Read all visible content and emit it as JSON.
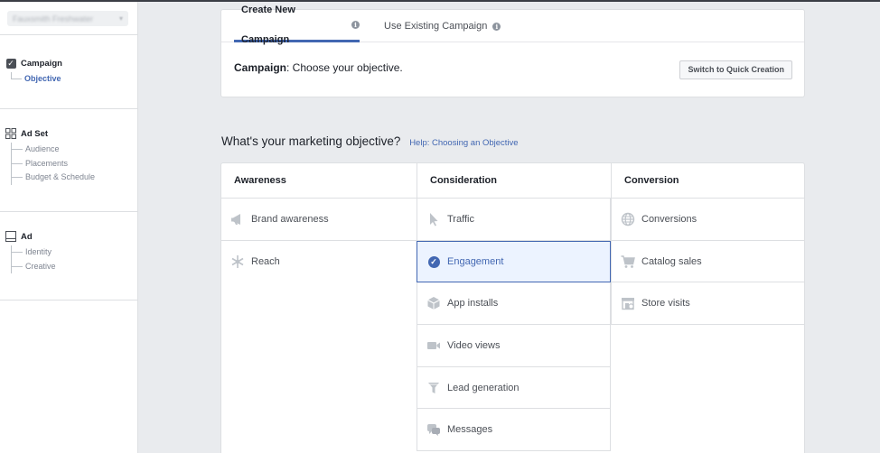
{
  "account": {
    "name": "Fauxsmith Freshwater",
    "caret": "▾"
  },
  "sidebar": {
    "campaign": {
      "title": "Campaign",
      "items": [
        "Objective"
      ]
    },
    "adset": {
      "title": "Ad Set",
      "items": [
        "Audience",
        "Placements",
        "Budget & Schedule"
      ]
    },
    "ad": {
      "title": "Ad",
      "items": [
        "Identity",
        "Creative"
      ]
    }
  },
  "tabs": [
    {
      "label": "Create New Campaign"
    },
    {
      "label": "Use Existing Campaign"
    }
  ],
  "campaign_row": {
    "bold": "Campaign",
    "rest": ": Choose your objective."
  },
  "quick_button": "Switch to Quick Creation",
  "heading": {
    "title": "What's your marketing objective?",
    "help": "Help: Choosing an Objective"
  },
  "objectives": {
    "awareness": {
      "title": "Awareness",
      "items": [
        "Brand awareness",
        "Reach"
      ]
    },
    "consideration": {
      "title": "Consideration",
      "items": [
        "Traffic",
        "Engagement",
        "App installs",
        "Video views",
        "Lead generation",
        "Messages"
      ],
      "selected": "Engagement"
    },
    "conversion": {
      "title": "Conversion",
      "items": [
        "Conversions",
        "Catalog sales",
        "Store visits"
      ]
    }
  },
  "colors": {
    "accent": "#4267b2",
    "selected_bg": "#ecf3ff",
    "border": "#dddfe2",
    "page_bg": "#e9ebee"
  },
  "icons": {
    "brand_awareness": "megaphone-icon",
    "reach": "asterisk-icon",
    "traffic": "cursor-icon",
    "engagement": "check-circle-icon",
    "app_installs": "box-icon",
    "video_views": "video-camera-icon",
    "lead_generation": "funnel-icon",
    "messages": "chat-bubbles-icon",
    "conversions": "globe-icon",
    "catalog_sales": "cart-icon",
    "store_visits": "store-icon"
  }
}
